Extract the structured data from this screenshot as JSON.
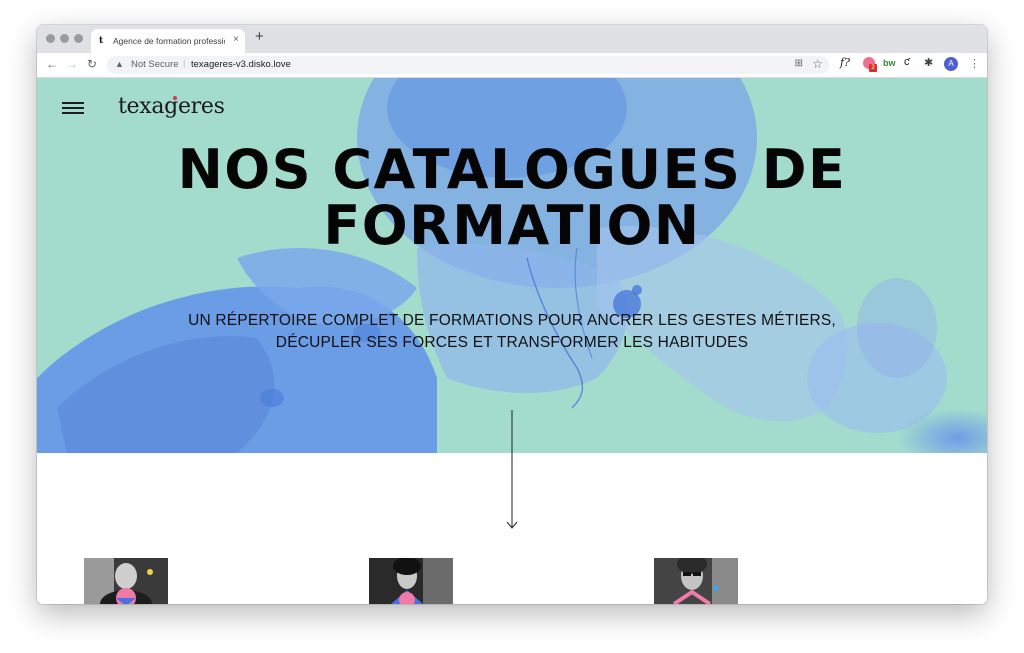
{
  "browser": {
    "tab_title": "Agence de formation professionnelle",
    "tab_close": "×",
    "new_tab": "+",
    "security_label": "Not Secure",
    "url": "texageres-v3.disko.love",
    "avatar_letter": "A",
    "extension_f_label": "f?",
    "extension_bw_label": "bw",
    "extension_badge": "2"
  },
  "site": {
    "logo_text": "texageres",
    "hero_title_line1": "NOS CATALOGUES DE",
    "hero_title_line2": "FORMATION",
    "hero_subtitle_line1": "UN RÉPERTOIRE COMPLET DE FORMATIONS POUR ANCRER LES GESTES MÉTIERS,",
    "hero_subtitle_line2": "DÉCUPLER SES FORCES ET TRANSFORMER LES HABITUDES"
  },
  "colors": {
    "hero_mint": "#a3dccd",
    "hero_blue": "#6b9ce6",
    "logo_accent": "#e0334f",
    "card_pink": "#f07aa8",
    "card_blue": "#4a6fe0",
    "card_yellow": "#f2d24a"
  }
}
